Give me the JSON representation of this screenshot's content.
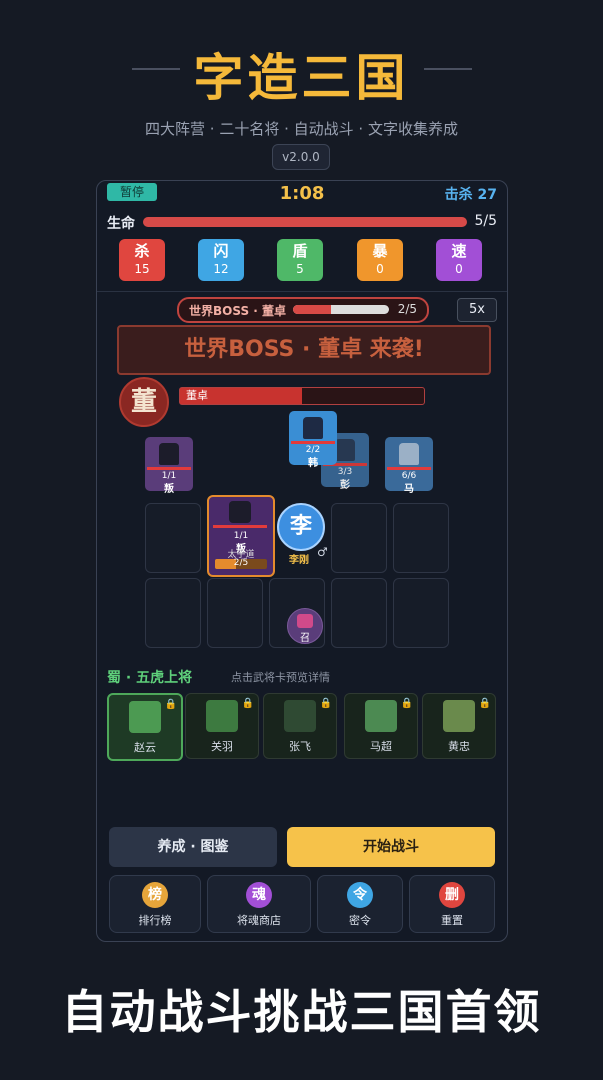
{
  "app": {
    "title": "字造三国",
    "subtitle": "四大阵营 · 二十名将 · 自动战斗 · 文字收集养成",
    "version": "v2.0.0"
  },
  "hud": {
    "pause": "暂停",
    "timer": "1:08",
    "kills": "击杀 27",
    "life_label": "生命",
    "life_value": "5/5",
    "life_fraction": 1.0
  },
  "stats": [
    {
      "name": "杀",
      "value": "15",
      "color": "#e0463f"
    },
    {
      "name": "闪",
      "value": "12",
      "color": "#3fa6e4"
    },
    {
      "name": "盾",
      "value": "5",
      "color": "#4fb868"
    },
    {
      "name": "暴",
      "value": "0",
      "color": "#f0962c"
    },
    {
      "name": "速",
      "value": "0",
      "color": "#a24fd6"
    }
  ],
  "boss": {
    "pill_label": "世界BOSS · 董卓",
    "pill_count": "2/5",
    "pill_fraction": 0.4,
    "speed": "5x",
    "banner": "世界BOSS · 董卓 来袭!",
    "glyph": "董",
    "hp_name": "董卓",
    "hp_fraction": 0.5
  },
  "enemies": [
    {
      "hp": "1/1",
      "char": "叛",
      "color": "#5a3d7a"
    },
    {
      "hp": "2/2",
      "char": "韩",
      "color": "#3a8ed4"
    },
    {
      "hp": "3/3",
      "char": "彭",
      "color": "#3a6a9a"
    },
    {
      "hp": "6/6",
      "char": "马",
      "color": "#3a6a9a"
    }
  ],
  "hero": {
    "hp": "1/1",
    "char": "叛",
    "name_label": "太乎道",
    "xp": "2/5",
    "xp_fraction": 0.4
  },
  "player": {
    "glyph": "李",
    "name": "李刚",
    "gender": "♂"
  },
  "pending": {
    "char": "召"
  },
  "camp": {
    "title": "蜀 · 五虎上将",
    "hint": "点击武将卡预览详情"
  },
  "generals": [
    {
      "name": "赵云",
      "selected": true
    },
    {
      "name": "关羽",
      "selected": false
    },
    {
      "name": "张飞",
      "selected": false
    },
    {
      "name": "马超",
      "selected": false
    },
    {
      "name": "黄忠",
      "selected": false
    }
  ],
  "buttons": {
    "grow": "养成 · 图鉴",
    "start": "开始战斗"
  },
  "tools": [
    {
      "icon": "榜",
      "label": "排行榜",
      "color": "#e6a53a"
    },
    {
      "icon": "魂",
      "label": "将魂商店",
      "color": "#a24fd6"
    },
    {
      "icon": "令",
      "label": "密令",
      "color": "#3fa6e4"
    },
    {
      "icon": "删",
      "label": "重置",
      "color": "#e0463f"
    }
  ],
  "tagline": "自动战斗挑战三国首领"
}
